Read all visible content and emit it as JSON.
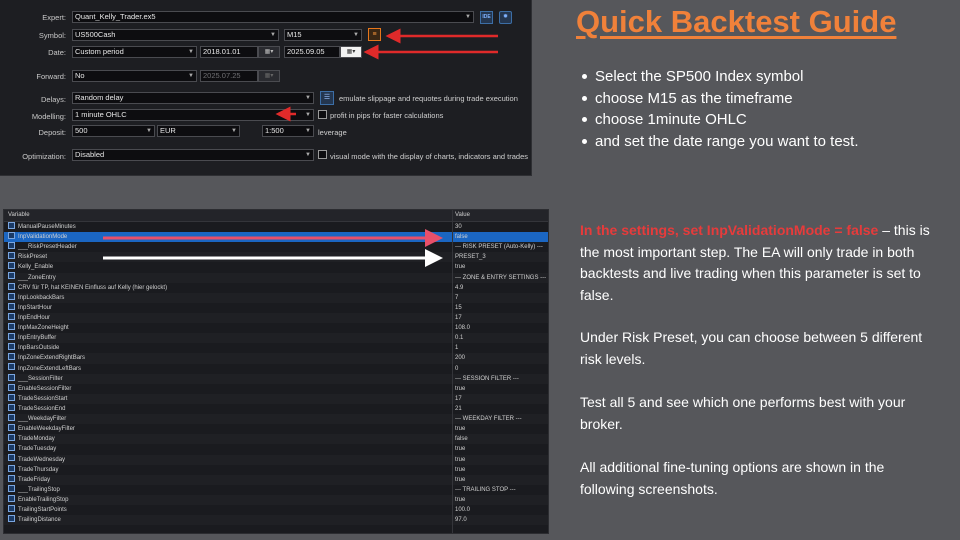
{
  "tester": {
    "expert_label": "Expert:",
    "expert_value": "Quant_Kelly_Trader.ex5",
    "symbol_label": "Symbol:",
    "symbol_value": "US500Cash",
    "timeframe_value": "M15",
    "date_label": "Date:",
    "date_mode": "Custom period",
    "date_from": "2018.01.01",
    "date_to": "2025.09.05",
    "forward_label": "Forward:",
    "forward_value": "No",
    "forward_date": "2025.07.25",
    "delays_label": "Delays:",
    "delays_value": "Random delay",
    "delays_note": "emulate slippage and requotes during trade execution",
    "modelling_label": "Modelling:",
    "modelling_value": "1 minute OHLC",
    "pips_note": "profit in pips for faster calculations",
    "deposit_label": "Deposit:",
    "deposit_value": "500",
    "currency_value": "EUR",
    "leverage_value": "1:500",
    "leverage_label": "leverage",
    "optimization_label": "Optimization:",
    "optimization_value": "Disabled",
    "visual_note": "visual mode with the display of charts, indicators and trades",
    "ide_icon_text": "IDE",
    "calendar_icon": "calendar-icon",
    "settings_icon": "gear-icon",
    "symbol_icon": "symbol-properties-icon"
  },
  "inputs": {
    "col_variable": "Variable",
    "col_value": "Value",
    "rows": [
      {
        "name": "ManualPauseMinutes",
        "value": "30"
      },
      {
        "name": "InpValidationMode",
        "value": "false"
      },
      {
        "name": "___RiskPresetHeader",
        "value": "--- RISK PRESET (Auto-Kelly) ---"
      },
      {
        "name": "RiskPreset",
        "value": "PRESET_3"
      },
      {
        "name": "Kelly_Enable",
        "value": "true"
      },
      {
        "name": "___ZoneEntry",
        "value": "--- ZONE & ENTRY SETTINGS ---"
      },
      {
        "name": "CRV für TP, hat KEINEN Einfluss auf Kelly (hier gelockt)",
        "value": "4.9"
      },
      {
        "name": "InpLookbackBars",
        "value": "7"
      },
      {
        "name": "InpStartHour",
        "value": "15"
      },
      {
        "name": "InpEndHour",
        "value": "17"
      },
      {
        "name": "InpMaxZoneHeight",
        "value": "108.0"
      },
      {
        "name": "InpEntryBuffer",
        "value": "0.1"
      },
      {
        "name": "InpBarsOutside",
        "value": "1"
      },
      {
        "name": "InpZoneExtendRightBars",
        "value": "200"
      },
      {
        "name": "InpZoneExtendLeftBars",
        "value": "0"
      },
      {
        "name": "___SessionFilter",
        "value": "--- SESSION FILTER ---"
      },
      {
        "name": "EnableSessionFilter",
        "value": "true"
      },
      {
        "name": "TradeSessionStart",
        "value": "17"
      },
      {
        "name": "TradeSessionEnd",
        "value": "21"
      },
      {
        "name": "___WeekdayFilter",
        "value": "--- WEEKDAY FILTER ---"
      },
      {
        "name": "EnableWeekdayFilter",
        "value": "true"
      },
      {
        "name": "TradeMonday",
        "value": "false"
      },
      {
        "name": "TradeTuesday",
        "value": "true"
      },
      {
        "name": "TradeWednesday",
        "value": "true"
      },
      {
        "name": "TradeThursday",
        "value": "true"
      },
      {
        "name": "TradeFriday",
        "value": "true"
      },
      {
        "name": "___TrailingStop",
        "value": "--- TRAILING STOP ---"
      },
      {
        "name": "EnableTrailingStop",
        "value": "true"
      },
      {
        "name": "TrailingStartPoints",
        "value": "100.0"
      },
      {
        "name": "TrailingDistance",
        "value": "97.0"
      }
    ],
    "selected_index": 1
  },
  "guide": {
    "title": "Quick Backtest Guide",
    "bullets": [
      "Select the SP500 Index symbol",
      "choose M15 as the timeframe",
      "choose 1minute OHLC",
      "and set the date range you want to test."
    ],
    "p1_highlight": "In the settings, set InpValidationMode = false",
    "p1_rest": " – this is the most important step. The EA will only trade in both backtests and live trading when this parameter is set to false.",
    "p2": "Under Risk Preset, you can choose between 5 different risk levels.",
    "p3": "Test all 5 and see which one performs best with your broker.",
    "p4": "All additional fine-tuning options are shown in the following screenshots."
  },
  "colors": {
    "background": "#56575b",
    "title_orange": "#f0813a",
    "highlight_red": "#e73b3b",
    "arrow_red": "#e02a2a",
    "arrow_pink": "#e8506a",
    "arrow_white": "#ffffff",
    "selection_blue": "#1b66c2"
  }
}
